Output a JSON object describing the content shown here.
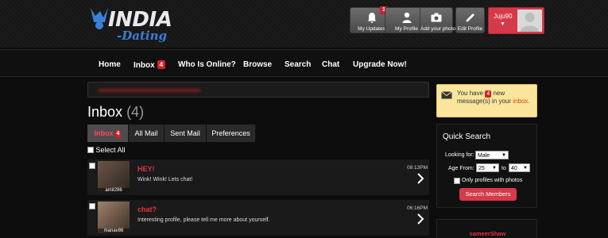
{
  "logo": {
    "text": "INDIA",
    "sub": "Dating"
  },
  "header_buttons": [
    {
      "label": "My Updates",
      "icon": "bell-icon",
      "badge": "1"
    },
    {
      "label": "My Profile",
      "icon": "person-icon"
    },
    {
      "label": "Add your photo",
      "icon": "camera-icon"
    },
    {
      "label": "Edit Profile",
      "icon": "pencil-icon"
    }
  ],
  "user": {
    "name": "Juju90",
    "caret": "▼"
  },
  "nav": {
    "home": "Home",
    "inbox": "Inbox",
    "inbox_badge": "4",
    "online": "Who Is Online?",
    "browse": "Browse",
    "search": "Search",
    "chat": "Chat",
    "upgrade": "Upgrade Now!"
  },
  "inbox": {
    "title": "Inbox",
    "count": "(4)",
    "select_all": "Select All"
  },
  "tabs": {
    "inbox": "Inbox",
    "inbox_badge": "4",
    "all": "All Mail",
    "sent": "Sent Mail",
    "prefs": "Preferences"
  },
  "messages": [
    {
      "subject": "HEY!",
      "preview": "Wink! Wink! Lets chat!",
      "time": "08:13PM",
      "username": "amit286"
    },
    {
      "subject": "chat?",
      "preview": "Interesting profile, please tell me more about yourself.",
      "time": "06:16PM",
      "username": "manav86"
    }
  ],
  "notice": {
    "pre": "You have",
    "count": "4",
    "post": "new message(s) in your",
    "link": "inbox."
  },
  "quick_search": {
    "title": "Quick Search",
    "looking_for_label": "Looking for:",
    "looking_for_value": "Male",
    "age_from_label": "Age From:",
    "age_from": "25",
    "to_label": "to",
    "age_to": "40",
    "photos_label": "Only profiles with photos",
    "button": "Search Members"
  },
  "profile_card": {
    "name": "sameerShaw"
  }
}
